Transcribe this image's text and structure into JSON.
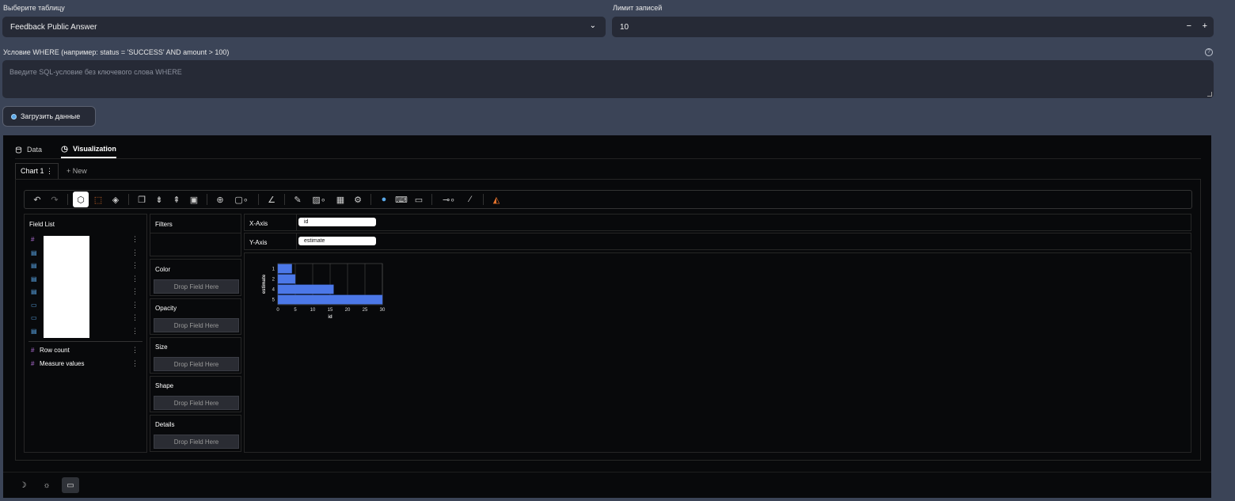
{
  "form": {
    "table_label": "Выберите таблицу",
    "table_value": "Feedback Public Answer",
    "limit_label": "Лимит записей",
    "limit_value": "10",
    "where_label": "Условие WHERE (например: status = 'SUCCESS' AND amount > 100)",
    "where_placeholder": "Введите SQL-условие без ключевого слова WHERE",
    "load_button": "Загрузить данные"
  },
  "tabs": [
    {
      "label": "Data",
      "icon": "database-icon"
    },
    {
      "label": "Visualization",
      "icon": "chart-icon",
      "active": true
    }
  ],
  "chart_tabs": {
    "current": "Chart 1",
    "new": "+ New"
  },
  "field_list": {
    "title": "Field List",
    "extra_fields": [
      {
        "name": "Row count",
        "icon": "#"
      },
      {
        "name": "Measure values",
        "icon": "#"
      }
    ]
  },
  "shelves": {
    "filters": "Filters",
    "color": "Color",
    "opacity": "Opacity",
    "size": "Size",
    "shape": "Shape",
    "details": "Details",
    "drop_hint": "Drop Field Here"
  },
  "axes": {
    "x_label": "X-Axis",
    "x_field": "id",
    "y_label": "Y-Axis",
    "y_field": "estimate"
  },
  "colors": {
    "bar": "#4c78e8",
    "accent": "#e5732d",
    "panel": "#08090b",
    "page": "#3b4457"
  },
  "chart_data": {
    "type": "bar",
    "orientation": "horizontal",
    "categories": [
      "1",
      "2",
      "4",
      "5"
    ],
    "values": [
      4,
      5,
      16,
      30
    ],
    "xlabel": "id",
    "ylabel": "estimate",
    "xlim": [
      0,
      30
    ],
    "xticks": [
      "0",
      "5",
      "10",
      "15",
      "20",
      "25",
      "30"
    ],
    "grid": true
  }
}
